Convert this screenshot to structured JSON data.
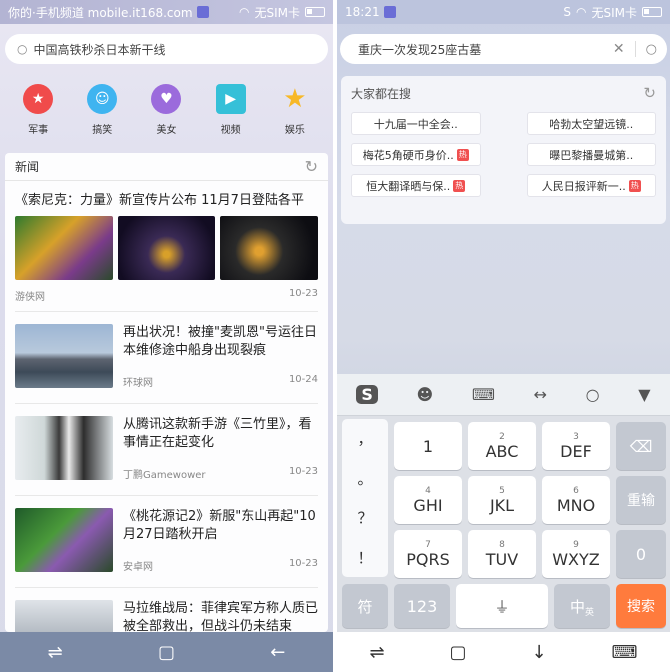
{
  "left": {
    "status": {
      "left_text": "你的·手机频道 mobile.it168.com",
      "carrier": "无SIM卡"
    },
    "search_placeholder": "中国高铁秒杀日本新干线",
    "categories": [
      {
        "label": "军事",
        "color": "#f04b4b",
        "glyph": "★"
      },
      {
        "label": "搞笑",
        "color": "#3fb4f0",
        "glyph": "☺"
      },
      {
        "label": "美女",
        "color": "#9b6bdc",
        "glyph": "♥"
      },
      {
        "label": "视频",
        "color": "#35c0d8",
        "glyph": "▶"
      },
      {
        "label": "娱乐",
        "color": "#f7b827",
        "glyph": "★"
      }
    ],
    "news_title": "新闻",
    "items": [
      {
        "title": "《索尼克：力量》新宣传片公布 11月7日登陆各平",
        "source": "游侠网",
        "date": "10-23"
      },
      {
        "title": "再出状况！被撞\"麦凯恩\"号运往日本维修途中船身出现裂痕",
        "source": "环球网",
        "date": "10-24"
      },
      {
        "title": "从腾讯这款新手游《三竹里》，看事情正在起变化",
        "source": "丁鹏Gamewower",
        "date": "10-23"
      },
      {
        "title": "《桃花源记2》新服\"东山再起\"10月27日踏秋开启",
        "source": "安卓网",
        "date": "10-23"
      },
      {
        "title": "马拉维战局：菲律宾军方称人质已被全部救出，但战斗仍未结束",
        "source": "",
        "date": ""
      }
    ]
  },
  "right": {
    "status": {
      "time": "18:21",
      "carrier": "无SIM卡"
    },
    "search_value": "重庆一次发现25座古墓",
    "hot_title": "大家都在搜",
    "hot_items": [
      {
        "label": "十九届一中全会..",
        "hot": false
      },
      {
        "label": "哈勃太空望远镜..",
        "hot": false
      },
      {
        "label": "梅花5角硬币身价..",
        "hot": true
      },
      {
        "label": "曝巴黎播曼城第..",
        "hot": false
      },
      {
        "label": "恒大翻译晒与保..",
        "hot": true
      },
      {
        "label": "人民日报评新一..",
        "hot": true
      }
    ],
    "hot_tag": "热",
    "keyboard": {
      "punct": [
        "，",
        "。",
        "？",
        "！"
      ],
      "rows": [
        [
          {
            "n": "",
            "l": "1"
          },
          {
            "n": "2",
            "l": "ABC"
          },
          {
            "n": "3",
            "l": "DEF"
          }
        ],
        [
          {
            "n": "4",
            "l": "GHI"
          },
          {
            "n": "5",
            "l": "JKL"
          },
          {
            "n": "6",
            "l": "MNO"
          }
        ],
        [
          {
            "n": "7",
            "l": "PQRS"
          },
          {
            "n": "8",
            "l": "TUV"
          },
          {
            "n": "9",
            "l": "WXYZ"
          }
        ]
      ],
      "retype": "重输",
      "zero": "0",
      "symbol": "符",
      "num123": "123",
      "cn": "中",
      "en": "英",
      "search": "搜索"
    }
  }
}
